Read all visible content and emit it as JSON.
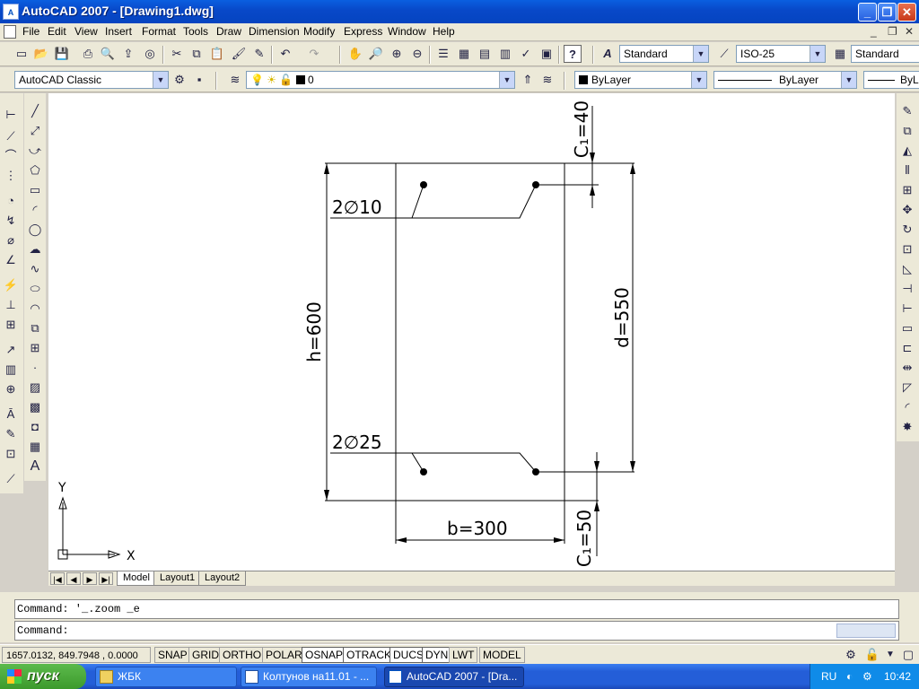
{
  "titlebar": {
    "app_icon_label": "A",
    "title": "AutoCAD 2007 - [Drawing1.dwg]",
    "minimize": "_",
    "restore": "❐",
    "close": "✕"
  },
  "menu": {
    "items": [
      "File",
      "Edit",
      "View",
      "Insert",
      "Format",
      "Tools",
      "Draw",
      "Dimension",
      "Modify",
      "Express",
      "Window",
      "Help"
    ],
    "doc_controls": [
      "_",
      "❐",
      "✕"
    ]
  },
  "toolbar_standard": {
    "text_style": "Standard",
    "dim_style": "ISO-25",
    "table_style": "Standard"
  },
  "toolbar_layers": {
    "workspace": "AutoCAD Classic",
    "layer": "0",
    "color": "ByLayer",
    "linetype": "ByLayer",
    "lineweight": "ByL"
  },
  "drawing": {
    "label_c1_top": "C₁=40",
    "label_bars_top": "2∅10",
    "label_h": "h=600",
    "label_d": "d=550",
    "label_bars_bottom": "2∅25",
    "label_b": "b=300",
    "label_c1_bottom": "C₁=50",
    "ucs_x": "X",
    "ucs_y": "Y"
  },
  "tabs": {
    "nav": [
      "|◀",
      "◀",
      "▶",
      "▶|"
    ],
    "model": "Model",
    "layout1": "Layout1",
    "layout2": "Layout2"
  },
  "command": {
    "history": "Command: '_.zoom _e",
    "prompt": "Command:"
  },
  "status": {
    "coords": "1657.0132, 849.7948 , 0.0000",
    "buttons": [
      "SNAP",
      "GRID",
      "ORTHO",
      "POLAR",
      "OSNAP",
      "OTRACK",
      "DUCS",
      "DYN",
      "LWT",
      "MODEL"
    ]
  },
  "taskbar": {
    "start": "пуск",
    "tasks": [
      "ЖБК",
      "Колтунов на11.01 - ...",
      "AutoCAD 2007 - [Dra..."
    ],
    "lang": "RU",
    "clock": "10:42"
  },
  "colors": {
    "title_blue": "#0848c8",
    "taskbar_blue": "#245ed8",
    "start_green": "#3c9a2c",
    "toolbar_bg": "#ece9d8"
  }
}
